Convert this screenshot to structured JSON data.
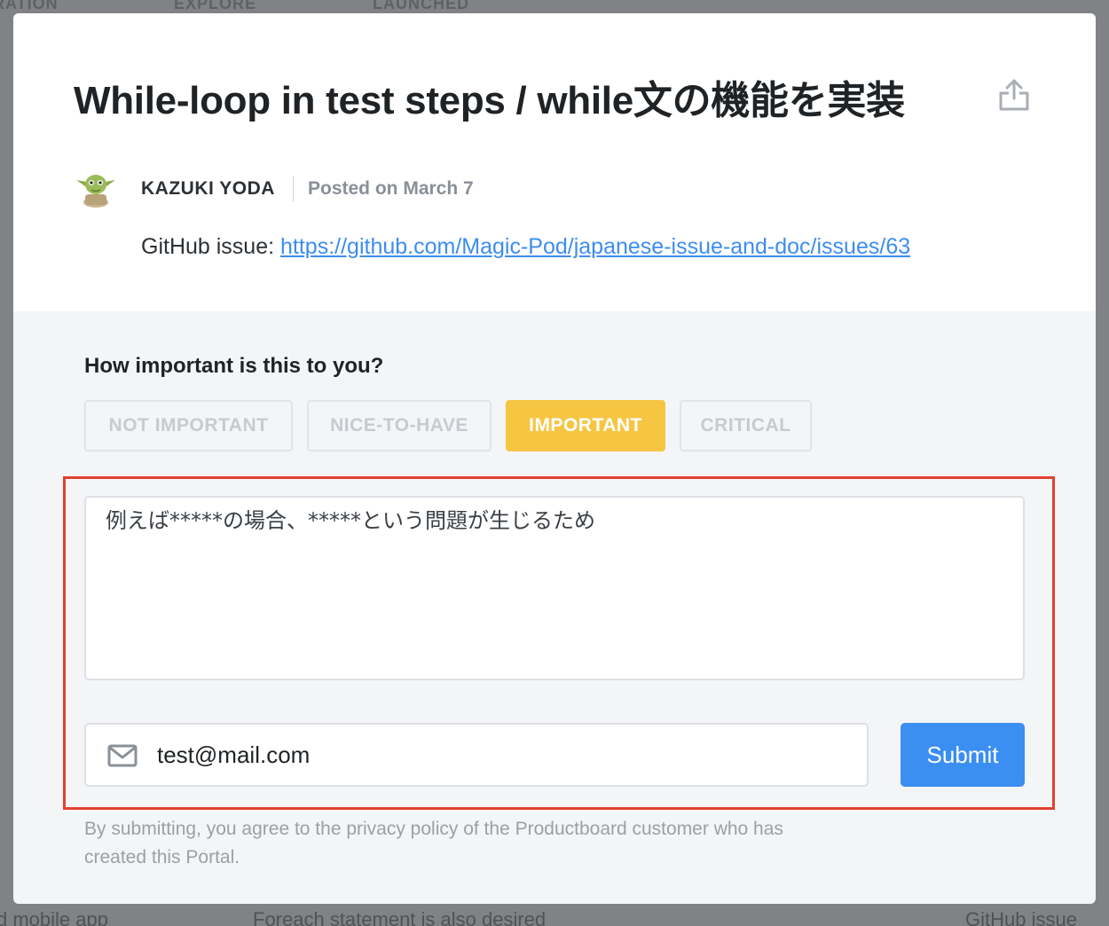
{
  "background": {
    "tabs": [
      "RATION",
      "EXPLORE",
      "LAUNCHED"
    ],
    "bottom_texts": [
      "d mobile app",
      "Foreach statement is also desired",
      "GitHub issue"
    ]
  },
  "post": {
    "title": "While-loop in test steps / while文の機能を実装",
    "author": "KAZUKI YODA",
    "posted": "Posted on March 7",
    "description_prefix": "GitHub issue: ",
    "description_link": "https://github.com/Magic-Pod/japanese-issue-and-doc/issues/63",
    "share_icon": "share-icon",
    "avatar_icon": "yoda-avatar"
  },
  "feedback": {
    "question": "How important is this to you?",
    "options": [
      {
        "label": "NOT IMPORTANT",
        "selected": false
      },
      {
        "label": "NICE-TO-HAVE",
        "selected": false
      },
      {
        "label": "IMPORTANT",
        "selected": true
      },
      {
        "label": "CRITICAL",
        "selected": false
      }
    ],
    "comment_value": "例えば*****の場合、*****という問題が生じるため",
    "email_value": "test@mail.com",
    "email_icon": "mail-icon",
    "submit_label": "Submit",
    "disclaimer": "By submitting, you agree to the privacy policy of the Productboard customer who has created this Portal."
  },
  "colors": {
    "selected_option": "#f6c643",
    "submit": "#3b8ef2",
    "link": "#3c8df0",
    "highlight_border": "#e2412f"
  }
}
